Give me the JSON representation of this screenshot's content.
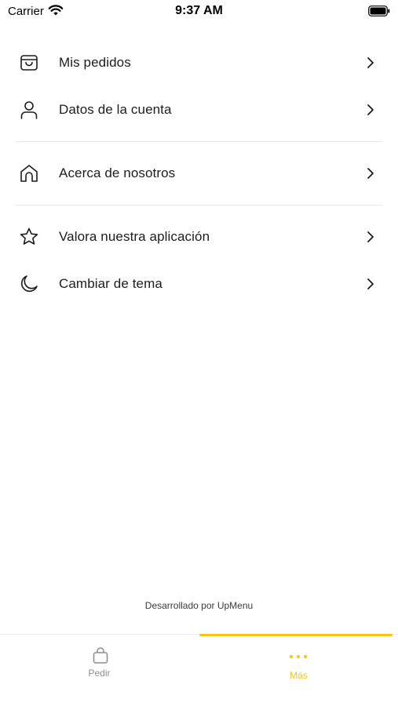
{
  "status_bar": {
    "carrier": "Carrier",
    "time": "9:37 AM"
  },
  "menu": {
    "groups": [
      [
        {
          "label": "Mis pedidos",
          "icon": "bag-icon"
        },
        {
          "label": "Datos de la cuenta",
          "icon": "user-icon"
        }
      ],
      [
        {
          "label": "Acerca de nosotros",
          "icon": "home-icon"
        }
      ],
      [
        {
          "label": "Valora nuestra aplicación",
          "icon": "star-icon"
        },
        {
          "label": "Cambiar de tema",
          "icon": "moon-icon"
        }
      ]
    ]
  },
  "footer": {
    "credit": "Desarrollado por UpMenu"
  },
  "tab_bar": {
    "tabs": [
      {
        "label": "Pedir",
        "icon": "shopping-bag-icon",
        "active": false
      },
      {
        "label": "Más",
        "icon": "more-dots-icon",
        "active": true
      }
    ],
    "active_color": "#f5c518",
    "inactive_color": "#8e8e93"
  }
}
